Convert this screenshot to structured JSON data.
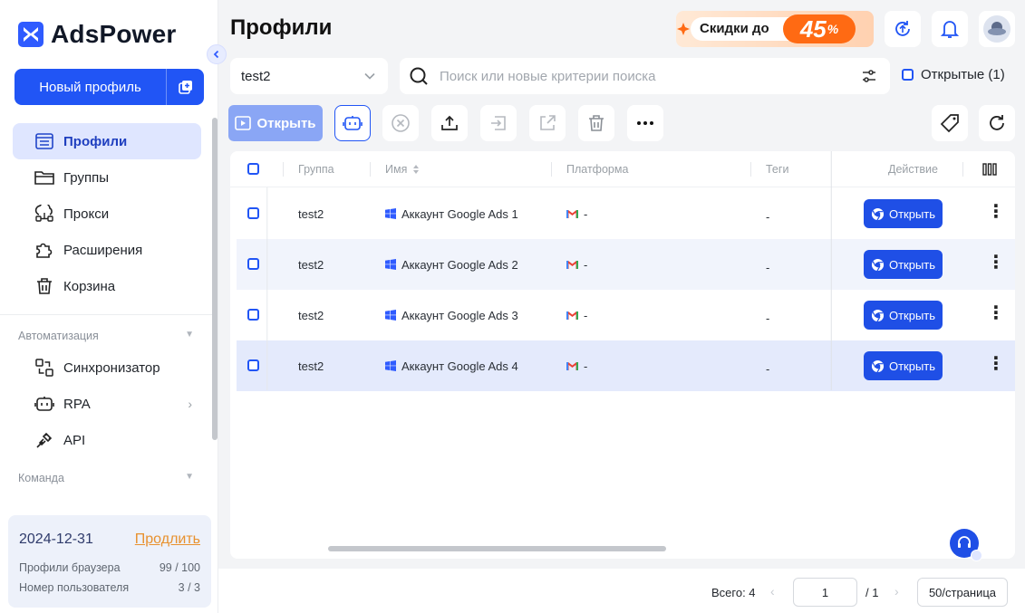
{
  "app": {
    "name": "AdsPower"
  },
  "sidebar": {
    "new_profile_label": "Новый профиль",
    "items": [
      {
        "label": "Профили",
        "icon": "profiles-icon",
        "active": true
      },
      {
        "label": "Группы",
        "icon": "folder-icon"
      },
      {
        "label": "Прокси",
        "icon": "proxy-icon"
      },
      {
        "label": "Расширения",
        "icon": "puzzle-icon"
      },
      {
        "label": "Корзина",
        "icon": "trash-icon"
      }
    ],
    "automation_title": "Автоматизация",
    "automation_items": [
      {
        "label": "Синхронизатор",
        "icon": "sync-icon"
      },
      {
        "label": "RPA",
        "icon": "robot-icon"
      },
      {
        "label": "API",
        "icon": "api-plug-icon"
      }
    ],
    "team_title": "Команда",
    "account": {
      "expiry_date": "2024-12-31",
      "renew_label": "Продлить",
      "browser_profiles_label": "Профили браузера",
      "browser_profiles_value": "99 / 100",
      "user_number_label": "Номер пользователя",
      "user_number_value": "3 / 3"
    }
  },
  "header": {
    "title": "Профили",
    "promo_text": "Скидки до",
    "promo_value": "45",
    "promo_unit": "%"
  },
  "filters": {
    "group_value": "test2",
    "search_placeholder": "Поиск или новые критерии поиска",
    "opened_label": "Открытые (1)"
  },
  "toolbar": {
    "open_label": "Открыть"
  },
  "table": {
    "columns": [
      "Группа",
      "Имя",
      "Платформа",
      "Теги",
      "Действие"
    ],
    "rows": [
      {
        "group": "test2",
        "name": "Аккаунт Google Ads 1",
        "platform": "-",
        "tags": "-",
        "action": "Открыть"
      },
      {
        "group": "test2",
        "name": "Аккаунт Google Ads 2",
        "platform": "-",
        "tags": "-",
        "action": "Открыть"
      },
      {
        "group": "test2",
        "name": "Аккаунт Google Ads 3",
        "platform": "-",
        "tags": "-",
        "action": "Открыть"
      },
      {
        "group": "test2",
        "name": "Аккаунт Google Ads 4",
        "platform": "-",
        "tags": "-",
        "action": "Открыть"
      }
    ]
  },
  "pagination": {
    "total_label": "Всего: 4",
    "current_page": "1",
    "of_pages": "/ 1",
    "page_size": "50/страница"
  },
  "colors": {
    "primary": "#2155f5",
    "promo_orange": "#ff6a13",
    "renew": "#e8912e"
  }
}
